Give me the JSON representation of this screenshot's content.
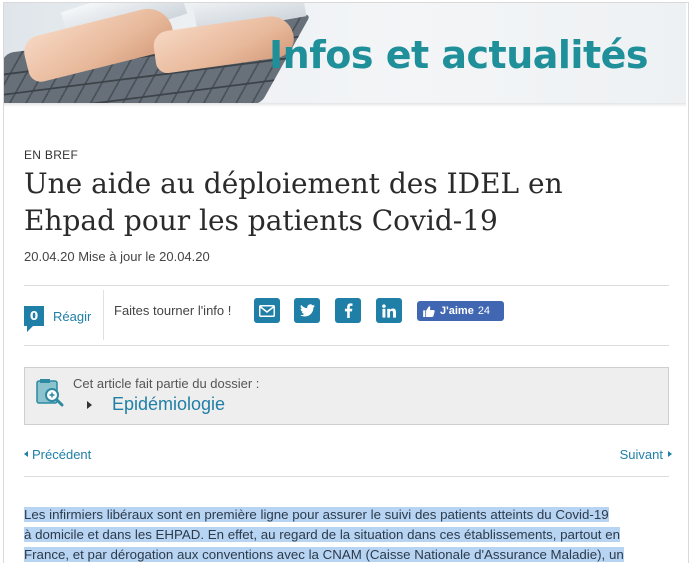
{
  "banner": {
    "title": "Infos et actualités"
  },
  "article": {
    "kicker": "EN BREF",
    "title": "Une aide au déploiement des IDEL en Ehpad pour les patients Covid-19",
    "date": "20.04.20 Mise à jour le 20.04.20"
  },
  "social": {
    "comment_count": "0",
    "react_label": "Réagir",
    "share_text": "Faites tourner l'info !",
    "buttons": [
      {
        "name": "email",
        "icon": "envelope-icon"
      },
      {
        "name": "twitter",
        "icon": "twitter-icon"
      },
      {
        "name": "facebook",
        "icon": "facebook-icon"
      },
      {
        "name": "linkedin",
        "icon": "linkedin-icon"
      }
    ],
    "like_label": "J'aime",
    "like_count": "24"
  },
  "dossier": {
    "note": "Cet article fait partie du dossier :",
    "link": "Epidémiologie"
  },
  "nav": {
    "prev": "Précédent",
    "next": "Suivant"
  },
  "body": {
    "lines": [
      "Les infirmiers libéraux sont en première ligne pour assurer le suivi des patients atteints du Covid-19",
      "à domicile et dans les EHPAD. En effet, au regard de la situation dans ces établissements, partout en",
      "France, et par dérogation aux conventions avec la CNAM (Caisse Nationale d'Assurance Maladie), un"
    ]
  },
  "colors": {
    "accent": "#1f7fa6",
    "banner_title": "#1f8f99",
    "facebook": "#4267b2",
    "selection": "#b8d4f3"
  }
}
